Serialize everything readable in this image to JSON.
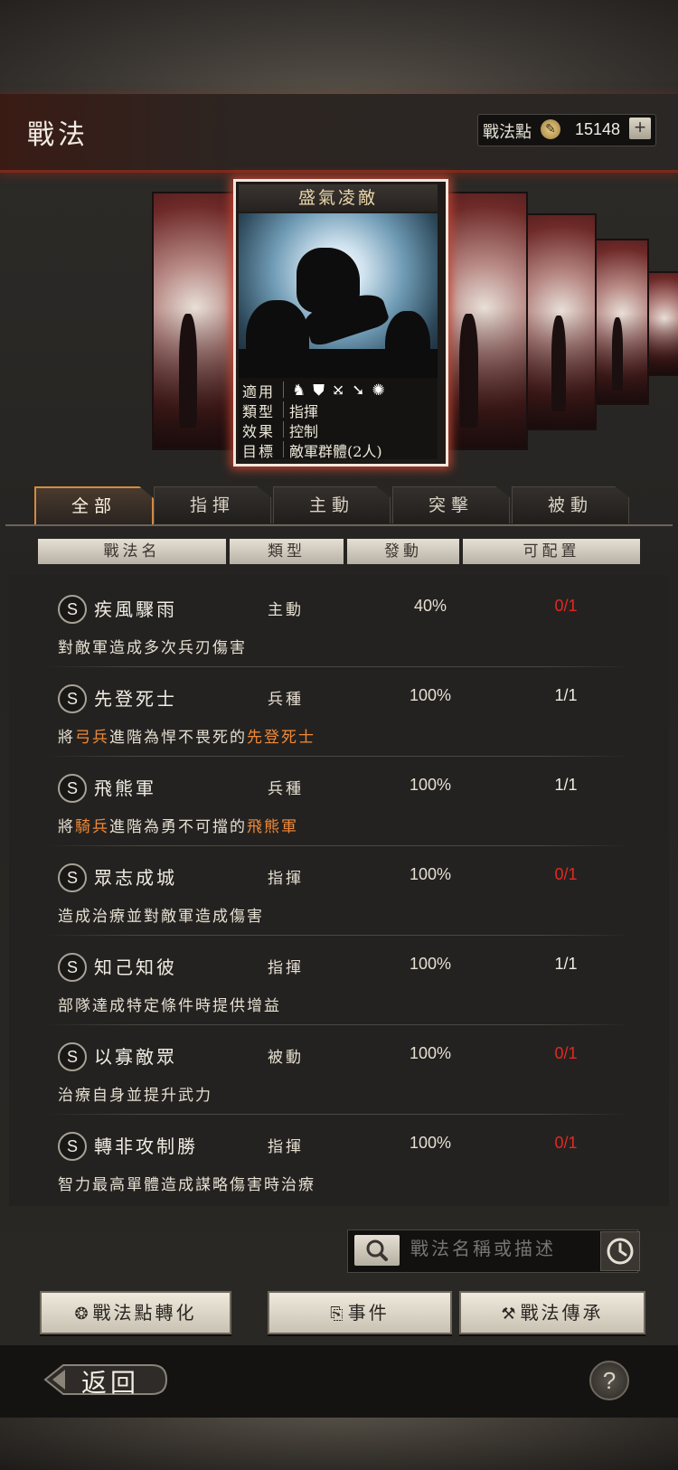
{
  "header": {
    "title": "戰法",
    "points_label": "戰法點",
    "points_value": "15148",
    "points_add": "+"
  },
  "featured": {
    "name": "盛氣凌敵",
    "rows": [
      {
        "label": "適用",
        "value": ""
      },
      {
        "label": "類型",
        "value": "指揮"
      },
      {
        "label": "效果",
        "value": "控制"
      },
      {
        "label": "目標",
        "value": "敵軍群體(2人)"
      }
    ],
    "troop_icons": [
      "cavalry-icon",
      "shield-icon",
      "bow-icon",
      "spear-icon",
      "siege-icon"
    ]
  },
  "tabs": [
    {
      "label": "全部",
      "active": true
    },
    {
      "label": "指揮",
      "active": false
    },
    {
      "label": "主動",
      "active": false
    },
    {
      "label": "突擊",
      "active": false
    },
    {
      "label": "被動",
      "active": false
    }
  ],
  "columns": [
    "戰法名",
    "類型",
    "發動",
    "可配置"
  ],
  "tactics": [
    {
      "grade": "S",
      "name": "疾風驟雨",
      "type": "主動",
      "rate": "40%",
      "slots": "0/1",
      "desc": "對敵軍造成多次兵刃傷害"
    },
    {
      "grade": "S",
      "name": "先登死士",
      "type": "兵種",
      "rate": "100%",
      "slots": "1/1",
      "desc_pre": "將",
      "desc_hl1": "弓兵",
      "desc_mid": "進階為悍不畏死的",
      "desc_hl2": "先登死士"
    },
    {
      "grade": "S",
      "name": "飛熊軍",
      "type": "兵種",
      "rate": "100%",
      "slots": "1/1",
      "desc_pre": "將",
      "desc_hl1": "騎兵",
      "desc_mid": "進階為勇不可擋的",
      "desc_hl2": "飛熊軍"
    },
    {
      "grade": "S",
      "name": "眾志成城",
      "type": "指揮",
      "rate": "100%",
      "slots": "0/1",
      "desc": "造成治療並對敵軍造成傷害"
    },
    {
      "grade": "S",
      "name": "知己知彼",
      "type": "指揮",
      "rate": "100%",
      "slots": "1/1",
      "desc": "部隊達成特定條件時提供增益"
    },
    {
      "grade": "S",
      "name": "以寡敵眾",
      "type": "被動",
      "rate": "100%",
      "slots": "0/1",
      "desc": "治療自身並提升武力"
    },
    {
      "grade": "S",
      "name": "轉非攻制勝",
      "type": "指揮",
      "rate": "100%",
      "slots": "0/1",
      "desc": "智力最高單體造成謀略傷害時治療"
    }
  ],
  "search": {
    "placeholder": "戰法名稱或描述"
  },
  "buttons": {
    "convert": "戰法點轉化",
    "event": "事件",
    "inherit": "戰法傳承"
  },
  "footer": {
    "back": "返回",
    "help": "?"
  },
  "colors": {
    "accent_orange": "#ee8a3a",
    "slot_full_red": "#e02a22",
    "active_tab_border": "#d48a40"
  }
}
